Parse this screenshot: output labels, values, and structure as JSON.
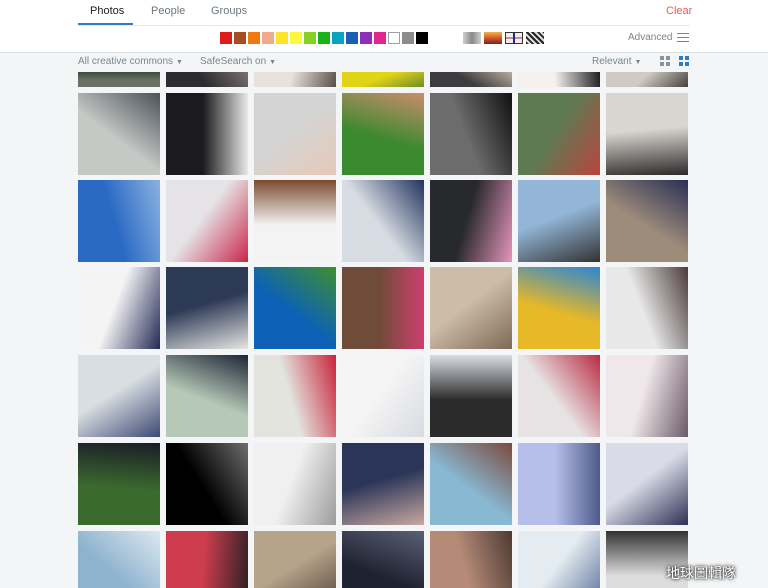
{
  "tabs": [
    "Photos",
    "People",
    "Groups"
  ],
  "clear_label": "Clear",
  "color_swatches": [
    "#e01b1b",
    "#a84d1f",
    "#f0780e",
    "#f3a98b",
    "#fce32c",
    "#fef83a",
    "#85d225",
    "#16b31b",
    "#07a4c1",
    "#1a5fb4",
    "#8d2db8",
    "#e0258e",
    "#ffffff",
    "#8c8c8c",
    "#000000"
  ],
  "style_filters": [
    "black-and-white-style",
    "shallow-depth-of-field-style",
    "minimalist-style",
    "patterns-style"
  ],
  "advanced_label": "Advanced",
  "license_filter": "All creative commons",
  "safesearch_filter": "SafeSearch on",
  "sort_filter": "Relevant",
  "view_buttons": [
    "small-grid-view-icon",
    "large-grid-view-icon"
  ],
  "watermark": "地球圖輯隊",
  "photos": [
    {
      "row": 0,
      "col": 0,
      "colors": [
        "#6a7266",
        "#3b4b3c"
      ]
    },
    {
      "row": 0,
      "col": 1,
      "colors": [
        "#2c2c2e",
        "#7a6f72"
      ]
    },
    {
      "row": 0,
      "col": 2,
      "colors": [
        "#e8e2dc",
        "#5b4f49"
      ]
    },
    {
      "row": 0,
      "col": 3,
      "colors": [
        "#e1d417",
        "#6e8d2b"
      ]
    },
    {
      "row": 0,
      "col": 4,
      "colors": [
        "#3d3c3e",
        "#b8ad9f"
      ]
    },
    {
      "row": 0,
      "col": 5,
      "colors": [
        "#f4f1ee",
        "#1f1f22"
      ]
    },
    {
      "row": 0,
      "col": 6,
      "colors": [
        "#cfcbc4",
        "#45403b"
      ]
    },
    {
      "row": 1,
      "col": 0,
      "colors": [
        "#c6c8c5",
        "#4a525a"
      ]
    },
    {
      "row": 1,
      "col": 1,
      "colors": [
        "#1b1b1d",
        "#ebe9e7"
      ]
    },
    {
      "row": 1,
      "col": 2,
      "colors": [
        "#d4d4d4",
        "#e6c9b7"
      ]
    },
    {
      "row": 1,
      "col": 3,
      "colors": [
        "#3c8a2f",
        "#c98d6d"
      ]
    },
    {
      "row": 1,
      "col": 4,
      "colors": [
        "#6c6c6c",
        "#111113"
      ]
    },
    {
      "row": 1,
      "col": 5,
      "colors": [
        "#5e7a53",
        "#b9453e"
      ]
    },
    {
      "row": 1,
      "col": 6,
      "colors": [
        "#d9d6cf",
        "#2b2a2a"
      ]
    },
    {
      "row": 2,
      "col": 0,
      "colors": [
        "#2a69c4",
        "#8ab2e0"
      ]
    },
    {
      "row": 2,
      "col": 1,
      "colors": [
        "#e5e3e5",
        "#c9264b"
      ]
    },
    {
      "row": 2,
      "col": 2,
      "colors": [
        "#f3f3f3",
        "#7b4b2f"
      ]
    },
    {
      "row": 2,
      "col": 3,
      "colors": [
        "#d7dce3",
        "#21335e"
      ]
    },
    {
      "row": 2,
      "col": 4,
      "colors": [
        "#28292c",
        "#e596bd"
      ]
    },
    {
      "row": 2,
      "col": 5,
      "colors": [
        "#93b6d8",
        "#323232"
      ]
    },
    {
      "row": 2,
      "col": 6,
      "colors": [
        "#9d8c7a",
        "#2a2f55"
      ]
    },
    {
      "row": 3,
      "col": 0,
      "colors": [
        "#f4f4f5",
        "#232a55"
      ]
    },
    {
      "row": 3,
      "col": 1,
      "colors": [
        "#2d3a56",
        "#e6e5e2"
      ]
    },
    {
      "row": 3,
      "col": 2,
      "colors": [
        "#0d61b6",
        "#3f8f2f"
      ]
    },
    {
      "row": 3,
      "col": 3,
      "colors": [
        "#6f4b3a",
        "#cf3f6e"
      ]
    },
    {
      "row": 3,
      "col": 4,
      "colors": [
        "#cdbca8",
        "#7d6a55"
      ]
    },
    {
      "row": 3,
      "col": 5,
      "colors": [
        "#e7b828",
        "#2a85d4"
      ]
    },
    {
      "row": 3,
      "col": 6,
      "colors": [
        "#e8e8e8",
        "#4a3a3a"
      ]
    },
    {
      "row": 4,
      "col": 0,
      "colors": [
        "#d9dee2",
        "#3d4a73"
      ]
    },
    {
      "row": 4,
      "col": 1,
      "colors": [
        "#b6c9b8",
        "#1d2535"
      ]
    },
    {
      "row": 4,
      "col": 2,
      "colors": [
        "#e3e4de",
        "#c8223a"
      ]
    },
    {
      "row": 4,
      "col": 3,
      "colors": [
        "#f5f5f5",
        "#d9dbe1"
      ]
    },
    {
      "row": 4,
      "col": 4,
      "colors": [
        "#2b2b2b",
        "#dadde6"
      ]
    },
    {
      "row": 4,
      "col": 5,
      "colors": [
        "#e7e3e4",
        "#b82b41"
      ]
    },
    {
      "row": 4,
      "col": 6,
      "colors": [
        "#efe7e9",
        "#6b5a69"
      ]
    },
    {
      "row": 5,
      "col": 0,
      "colors": [
        "#3b6a2f",
        "#1b1c26"
      ]
    },
    {
      "row": 5,
      "col": 1,
      "colors": [
        "#000000",
        "#6e6e6e"
      ]
    },
    {
      "row": 5,
      "col": 2,
      "colors": [
        "#f0f0f0",
        "#9c9c9c"
      ]
    },
    {
      "row": 5,
      "col": 3,
      "colors": [
        "#2a3558",
        "#c9a8a0"
      ]
    },
    {
      "row": 5,
      "col": 4,
      "colors": [
        "#89b8d2",
        "#7a4a3e"
      ]
    },
    {
      "row": 5,
      "col": 5,
      "colors": [
        "#b6bfe9",
        "#4d5a8a"
      ]
    },
    {
      "row": 5,
      "col": 6,
      "colors": [
        "#d9dce6",
        "#2e2f55"
      ]
    },
    {
      "row": 6,
      "col": 0,
      "colors": [
        "#8eb3cf",
        "#dde8ee"
      ]
    },
    {
      "row": 6,
      "col": 1,
      "colors": [
        "#cd3d4e",
        "#2b1f24"
      ]
    },
    {
      "row": 6,
      "col": 2,
      "colors": [
        "#b7a28a",
        "#4e3f33"
      ]
    },
    {
      "row": 6,
      "col": 3,
      "colors": [
        "#1f2331",
        "#5a5f75"
      ]
    },
    {
      "row": 6,
      "col": 4,
      "colors": [
        "#b58b77",
        "#4e3a34"
      ]
    },
    {
      "row": 6,
      "col": 5,
      "colors": [
        "#e4ebf1",
        "#4f6a91"
      ]
    },
    {
      "row": 6,
      "col": 6,
      "colors": [
        "#ddd",
        "#333"
      ]
    }
  ]
}
